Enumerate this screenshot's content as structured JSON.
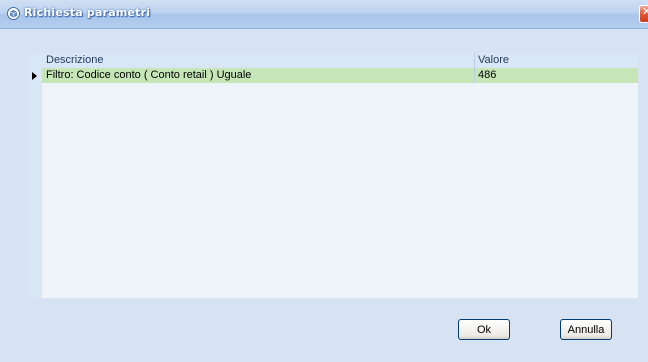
{
  "window": {
    "title": "Richiesta parametri",
    "close_icon": "close-icon"
  },
  "grid": {
    "columns": [
      "Descrizione",
      "Valore"
    ],
    "rows": [
      {
        "descrizione": "Filtro: Codice conto ( Conto retail ) Uguale",
        "valore": "486"
      }
    ]
  },
  "buttons": {
    "ok_label": "Ok",
    "cancel_label": "Annulla"
  },
  "colors": {
    "selected_row": "#c6e6b8",
    "grid_background": "#eef4fa",
    "header_background": "#d8e6f5"
  }
}
